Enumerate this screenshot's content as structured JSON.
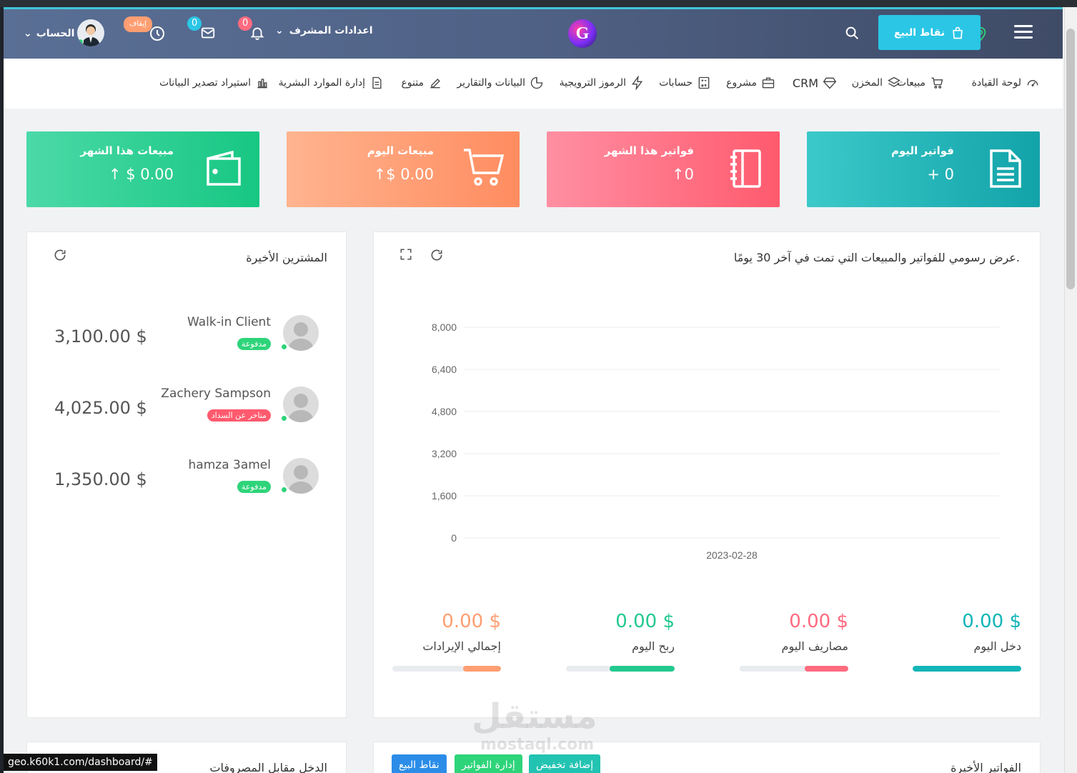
{
  "header": {
    "pos_label": "نقاط البيع",
    "admin_settings": "اعدادات المشرف",
    "notifications_count": "0",
    "messages_count": "0",
    "timer_label": "إيقاف",
    "account_label": "الحساب"
  },
  "nav": {
    "items": [
      {
        "label": "لوحة القيادة",
        "icon": "dashboard-icon"
      },
      {
        "label": "مبيعات",
        "icon": "cart-icon"
      },
      {
        "label": "المخزن",
        "icon": "layers-icon"
      },
      {
        "label": "CRM",
        "icon": "diamond-icon"
      },
      {
        "label": "مشروع",
        "icon": "briefcase-icon"
      },
      {
        "label": "حسابات",
        "icon": "calculator-icon"
      },
      {
        "label": "الرموز الترويجية",
        "icon": "bolt-icon"
      },
      {
        "label": "البيانات والتقارير",
        "icon": "pie-icon"
      },
      {
        "label": "متنوع",
        "icon": "edit-icon"
      },
      {
        "label": "إدارة الموارد البشرية",
        "icon": "document-icon"
      },
      {
        "label": "استيراد تصدير البيانات",
        "icon": "bar-chart-icon"
      }
    ]
  },
  "cards": [
    {
      "title": "فواتير اليوم",
      "value": "+ 0",
      "color": "#12a3a9"
    },
    {
      "title": "فواتير هذا الشهر",
      "value": "↑0",
      "color": "#ff5a6e"
    },
    {
      "title": "مبيعات اليوم",
      "value": "↑$ 0.00",
      "color": "#ff8c60"
    },
    {
      "title": "مبيعات هذا الشهر",
      "value": "↑ $ 0.00",
      "color": "#17c782"
    }
  ],
  "chart_panel": {
    "title": "عرض رسومي للفواتير والمبيعات التي تمت في آخر 30 يومًا.",
    "stats": [
      {
        "amount": "0.00 $",
        "label": "دخل اليوم",
        "color": "#12b5b8",
        "fill": 1.0
      },
      {
        "amount": "0.00 $",
        "label": "مصاريف اليوم",
        "color": "#ff6b7f",
        "fill": 0.4
      },
      {
        "amount": "0.00 $",
        "label": "ربح اليوم",
        "color": "#22c98f",
        "fill": 0.6
      },
      {
        "amount": "0.00 $",
        "label": "إجمالي الإيرادات",
        "color": "#ff9e72",
        "fill": 0.35
      }
    ]
  },
  "chart_data": {
    "type": "line",
    "x": [
      "2023-02-28"
    ],
    "series": [
      {
        "values": [
          0
        ]
      }
    ],
    "yticks": [
      "0",
      "1,600",
      "3,200",
      "4,800",
      "6,400",
      "8,000"
    ],
    "ylim": [
      0,
      8000
    ],
    "grid": true
  },
  "clients_panel": {
    "title": "المشترين الأخيرة",
    "clients": [
      {
        "name": "Walk-in Client",
        "status": "مدفوعة",
        "status_color": "#2ed47a",
        "amount": "3,100.00 $"
      },
      {
        "name": "Zachery Sampson",
        "status": "متاخر عن السداد",
        "status_color": "#ff5a6e",
        "amount": "4,025.00 $"
      },
      {
        "name": "hamza 3amel",
        "status": "مدفوعة",
        "status_color": "#2ed47a",
        "amount": "1,350.00 $"
      }
    ]
  },
  "invoices_panel": {
    "title": "الفواتير الأخيرة",
    "buttons": [
      {
        "label": "إضافة تخفيض",
        "color": "#22c3b1"
      },
      {
        "label": "إدارة الفواتير",
        "color": "#2ed47a"
      },
      {
        "label": "نقاط البيع",
        "color": "#2b8de8"
      }
    ]
  },
  "income_panel": {
    "title": "الدخل مقابل المصروفات"
  },
  "status_url": "geo.k60k1.com/dashboard/#",
  "watermark": {
    "arabic": "مستقل",
    "latin": "mostaql.com"
  }
}
